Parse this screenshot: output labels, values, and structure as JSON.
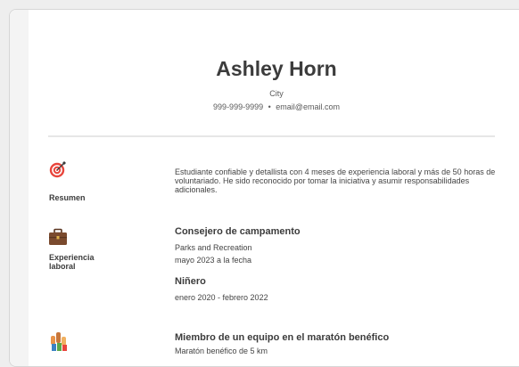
{
  "header": {
    "name": "Ashley Horn",
    "city": "City",
    "phone": "999-999-9999",
    "separator": "•",
    "email": "email@email.com"
  },
  "summary": {
    "label": "Resumen",
    "icon": "target-icon",
    "text": "Estudiante confiable y detallista con 4 meses de experiencia laboral y más de 50 horas de voluntariado. He sido reconocido por tomar la iniciativa y asumir responsabilidades adicionales."
  },
  "experience": {
    "label_line1": "Experiencia",
    "label_line2": "laboral",
    "icon": "briefcase-icon",
    "jobs": [
      {
        "title": "Consejero de campamento",
        "company": "Parks and Recreation",
        "dates": "mayo 2023 a la fecha"
      },
      {
        "title": "Niñero",
        "dates": "enero 2020 - febrero 2022"
      }
    ]
  },
  "volunteer": {
    "icon": "raised-hands-icon",
    "title": "Miembro de un equipo en el maratón benéfico",
    "detail": "Maratón benéfico de 5 km"
  },
  "colors": {
    "accent_target": "#e8453c",
    "briefcase": "#7a4a2e",
    "text_dark": "#3c3c3c"
  }
}
